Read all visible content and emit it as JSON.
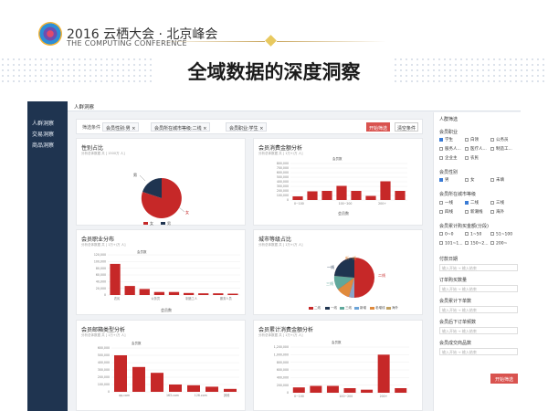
{
  "conference": {
    "line1": "2016 云栖大会 · 北京峰会",
    "line2": "THE COMPUTING CONFERENCE"
  },
  "page_title": "全域数据的深度洞察",
  "colors": {
    "accent": "#c62828",
    "nav": "#1f3450",
    "gold": "#e8c95f"
  },
  "sidebar": {
    "items": [
      {
        "label": "人群洞察"
      },
      {
        "label": "交易洞察"
      },
      {
        "label": "商品洞察"
      }
    ]
  },
  "header": {
    "breadcrumb": "人群洞察"
  },
  "filter": {
    "label": "筛选条件",
    "tags": [
      "会员性别:男 ×",
      "会员所在城市等级:二线 ×",
      "会员职业:学生 ×"
    ],
    "start_button": "开始筛选",
    "clear_button": "清空条件"
  },
  "cards": {
    "gender": {
      "title": "性别占比",
      "sub": "分析总体数据 共 [ 1500万 人]",
      "legend": [
        "女",
        "男"
      ]
    },
    "purchase": {
      "title": "会员消费金额分析",
      "sub": "分析总体数据 共 [ 1万+/万 人]",
      "unit": "会员数",
      "legend": "会员数",
      "yticks": [
        "800,000",
        "700,000",
        "600,000",
        "500,000",
        "400,000",
        "300,000",
        "200,000",
        "100,000",
        "0"
      ],
      "xticks": [
        "0~100",
        "100~200",
        "200+"
      ]
    },
    "occupation": {
      "title": "会员职业分布",
      "sub": "分析总体数据 共 [ 1万+/万 人]",
      "unit": "会员数",
      "legend": "会员数",
      "yticks": [
        "120,000",
        "100,000",
        "80,000",
        "60,000",
        "40,000",
        "20,000",
        "0"
      ],
      "xticks": [
        "农民",
        "公务员",
        "制造工人",
        "服务人员"
      ]
    },
    "city": {
      "title": "城市等级占比",
      "sub": "分析总体数据 共 [ 1万+/万 人]",
      "slice_labels": [
        "二线",
        "一线",
        "三线",
        "新一线",
        "四线"
      ],
      "legend": [
        "二线",
        "一线",
        "三线",
        "新增",
        "老增线",
        "海外"
      ]
    },
    "email": {
      "title": "会员邮箱类型分析",
      "sub": "分析总体数据 共 [ 1万+/万 人]",
      "unit": "会员数",
      "yticks": [
        "600,000",
        "500,000",
        "400,000",
        "300,000",
        "200,000",
        "100,000",
        "0"
      ],
      "xticks": [
        "qq.com",
        "163.com",
        "126.com",
        "其他"
      ]
    },
    "spend": {
      "title": "会员累计消费金额分析",
      "sub": "分析总体数据 共 [ 1万+/万 人]",
      "unit": "会员数",
      "yticks": [
        "1,200,000",
        "1,000,000",
        "800,000",
        "600,000",
        "400,000",
        "200,000",
        "0"
      ],
      "xticks": [
        "0~100",
        "100~200",
        "200+"
      ]
    }
  },
  "right_panel": {
    "title": "人群筛选",
    "occupation_title": "会员职业",
    "occupation_options": [
      {
        "label": "学生",
        "checked": true
      },
      {
        "label": "白领",
        "checked": false
      },
      {
        "label": "公务员",
        "checked": false
      },
      {
        "label": "服务人...",
        "checked": false
      },
      {
        "label": "医疗人...",
        "checked": false
      },
      {
        "label": "制造工...",
        "checked": false
      },
      {
        "label": "企业主",
        "checked": false
      },
      {
        "label": "农民",
        "checked": false
      }
    ],
    "gender_title": "会员性别",
    "gender_options": [
      {
        "label": "男",
        "checked": true
      },
      {
        "label": "女",
        "checked": false
      },
      {
        "label": "未填",
        "checked": false
      }
    ],
    "city_title": "会员所在城市等级",
    "city_options": [
      {
        "label": "一线",
        "checked": false
      },
      {
        "label": "二线",
        "checked": true
      },
      {
        "label": "三线",
        "checked": false
      },
      {
        "label": "四线",
        "checked": false
      },
      {
        "label": "新潮线",
        "checked": false
      },
      {
        "label": "海外",
        "checked": false
      }
    ],
    "amount_title": "会员累计购买金额(分段)",
    "amount_options": [
      {
        "label": "0~0",
        "checked": false
      },
      {
        "label": "1~50",
        "checked": false
      },
      {
        "label": "51~100",
        "checked": false
      },
      {
        "label": "101~1...",
        "checked": false
      },
      {
        "label": "150~2...",
        "checked": false
      },
      {
        "label": "200~",
        "checked": false
      }
    ],
    "pay_title": "付款日期",
    "pay_placeholder": "输入开始 → 输入结束",
    "order_title": "订单购买数量",
    "order_placeholder": "输入开始 → 输入结束",
    "last_order_title": "会员累计下单数",
    "last_order_placeholder": "输入开始 → 输入结束",
    "lastp_title": "会员后下订单频数",
    "lastp_placeholder": "输入开始 → 输入结束",
    "txn_title": "会员成交商品数",
    "txn_placeholder": "输入开始 → 输入结束",
    "button": "开始筛选"
  }
}
